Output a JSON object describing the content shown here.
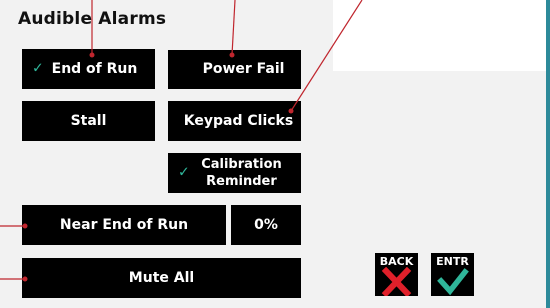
{
  "screen": {
    "title": "Audible Alarms"
  },
  "buttons": {
    "end_of_run": {
      "label": "End of Run",
      "checked": true
    },
    "power_fail": {
      "label": "Power Fail"
    },
    "stall": {
      "label": "Stall"
    },
    "keypad_clicks": {
      "label": "Keypad Clicks"
    },
    "calibration_reminder": {
      "line1": "Calibration",
      "line2": "Reminder",
      "checked": true
    },
    "near_end_of_run": {
      "label": "Near End of Run"
    },
    "near_end_percent": {
      "value": "0%"
    },
    "mute_all": {
      "label": "Mute All"
    }
  },
  "nav": {
    "back": {
      "label": "BACK",
      "icon": "red-x-icon"
    },
    "enter": {
      "label": "ENTR",
      "icon": "green-check-icon"
    }
  },
  "colors": {
    "accent_check": "#2fb69a",
    "back_x": "#e0202a",
    "enter_check": "#2fb69a",
    "callout_line": "#c0262e",
    "frame": "#2d8a9a"
  },
  "icons": {
    "checkmark": "✓"
  }
}
